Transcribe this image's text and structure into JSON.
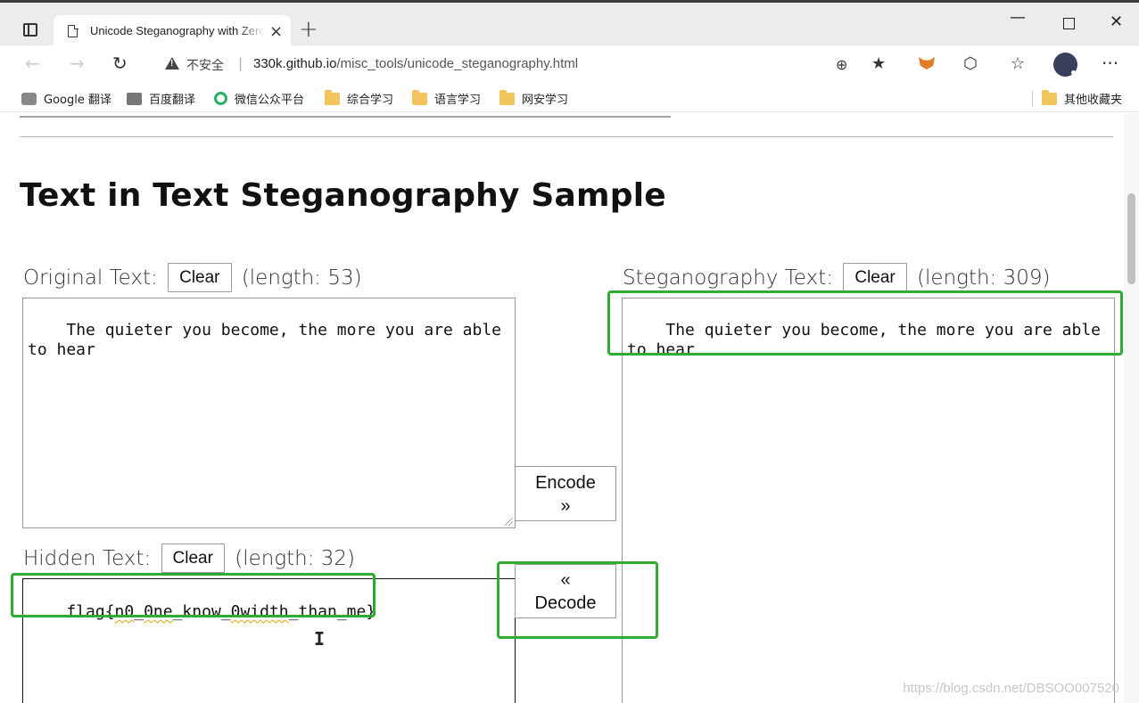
{
  "browser": {
    "tab_title": "Unicode Steganography with Zero-Width Characters",
    "tab_close": "×",
    "new_tab": "+",
    "security_label": "不安全",
    "url_separator": "|",
    "url_host": "330k.github.io",
    "url_path": "/misc_tools/unicode_steganography.html",
    "window_controls": {
      "minimize": "—",
      "close": "✕"
    },
    "icons": {
      "back": "←",
      "forward": "→",
      "reload": "↻",
      "zoom": "⊕",
      "star": "★",
      "extensions": "⬡",
      "favorites": "☆",
      "more": "···"
    }
  },
  "bookmarks": [
    {
      "label": "Google 翻译",
      "icon": "google-translate"
    },
    {
      "label": "百度翻译",
      "icon": "baidu-translate"
    },
    {
      "label": "微信公众平台",
      "icon": "wechat"
    },
    {
      "label": "综合学习",
      "icon": "folder"
    },
    {
      "label": "语言学习",
      "icon": "folder"
    },
    {
      "label": "网安学习",
      "icon": "folder"
    },
    {
      "label": "其他收藏夹",
      "icon": "folder"
    }
  ],
  "page": {
    "title": "Text in Text Steganography Sample",
    "original": {
      "label": "Original Text:",
      "clear": "Clear",
      "length": "(length: 53)",
      "value": "The quieter you become, the more you are able to hear"
    },
    "stego": {
      "label": "Steganography Text:",
      "clear": "Clear",
      "length": "(length: 309)",
      "value": "The quieter you become, the more you are able to hear"
    },
    "hidden": {
      "label": "Hidden Text:",
      "clear": "Clear",
      "length": "(length: 32)",
      "value_prefix": "flag{",
      "value_part1": "n0",
      "value_sep1": "_",
      "value_part2": "0ne",
      "value_sep2": "_know_",
      "value_part3": "0width",
      "value_suffix": "_than_me}"
    },
    "encode_button": {
      "line1": "Encode",
      "line2": "»"
    },
    "decode_button": {
      "line1": "«",
      "line2": "Decode"
    },
    "cursor": "I",
    "watermark": "https://blog.csdn.net/DBSOO007520"
  },
  "colors": {
    "highlight": "#2fac2f",
    "spellcheck": "#e0a500"
  }
}
